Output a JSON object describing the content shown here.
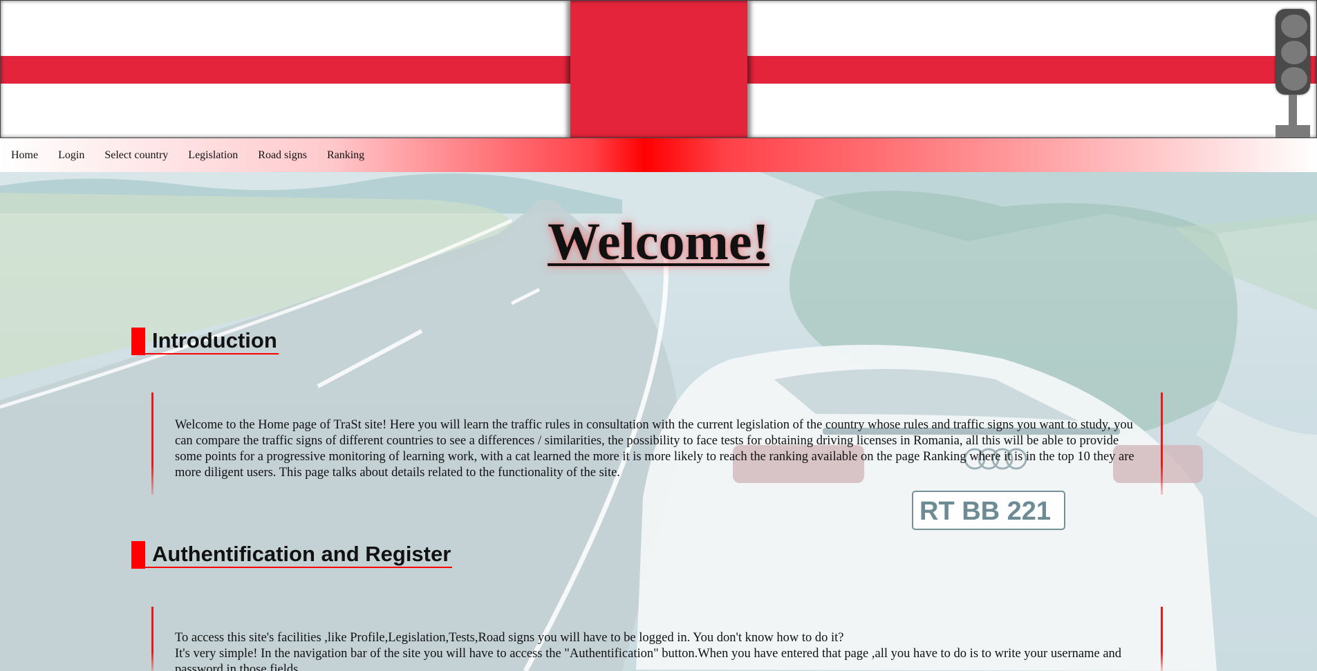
{
  "header": {
    "flag_colors": {
      "background": "#ffffff",
      "cross": "#e3243b"
    },
    "traffic_light_icon": "traffic-light-icon"
  },
  "nav": {
    "items": [
      "Home",
      "Login",
      "Select country",
      "Legislation",
      "Road signs",
      "Ranking"
    ],
    "gradient_accent": "#ff0000"
  },
  "main": {
    "title": "Welcome!",
    "sections": [
      {
        "heading": "Introduction",
        "paragraphs": [
          "Welcome to the Home page of TraSt site! Here you will learn the traffic rules in consultation with the current legislation of the country whose rules and traffic signs you want to study, you can compare the traffic signs of different countries to see a differences / similarities, the possibility to face tests for obtaining driving licenses in Romania, all this will be able to provide some points for a progressive monitoring of learning work, with a cat learned the more it is more likely to reach the ranking available on the page Ranking where it is in the top 10 they are more diligent users. This page talks about details related to the functionality of the site."
        ]
      },
      {
        "heading": "Authentification and Register",
        "paragraphs": [
          "To access this site's facilities ,like Profile,Legislation,Tests,Road signs you will have to be logged in. You don't know how to do it?",
          "It's very simple! In the navigation bar of the site you will have to access the \"Authentification\" button.When you have entered that page ,all you have to do is to write your username and password in those fields."
        ]
      }
    ],
    "accent_color": "#ff0000"
  },
  "background": {
    "license_plate": "RT BB 221"
  }
}
